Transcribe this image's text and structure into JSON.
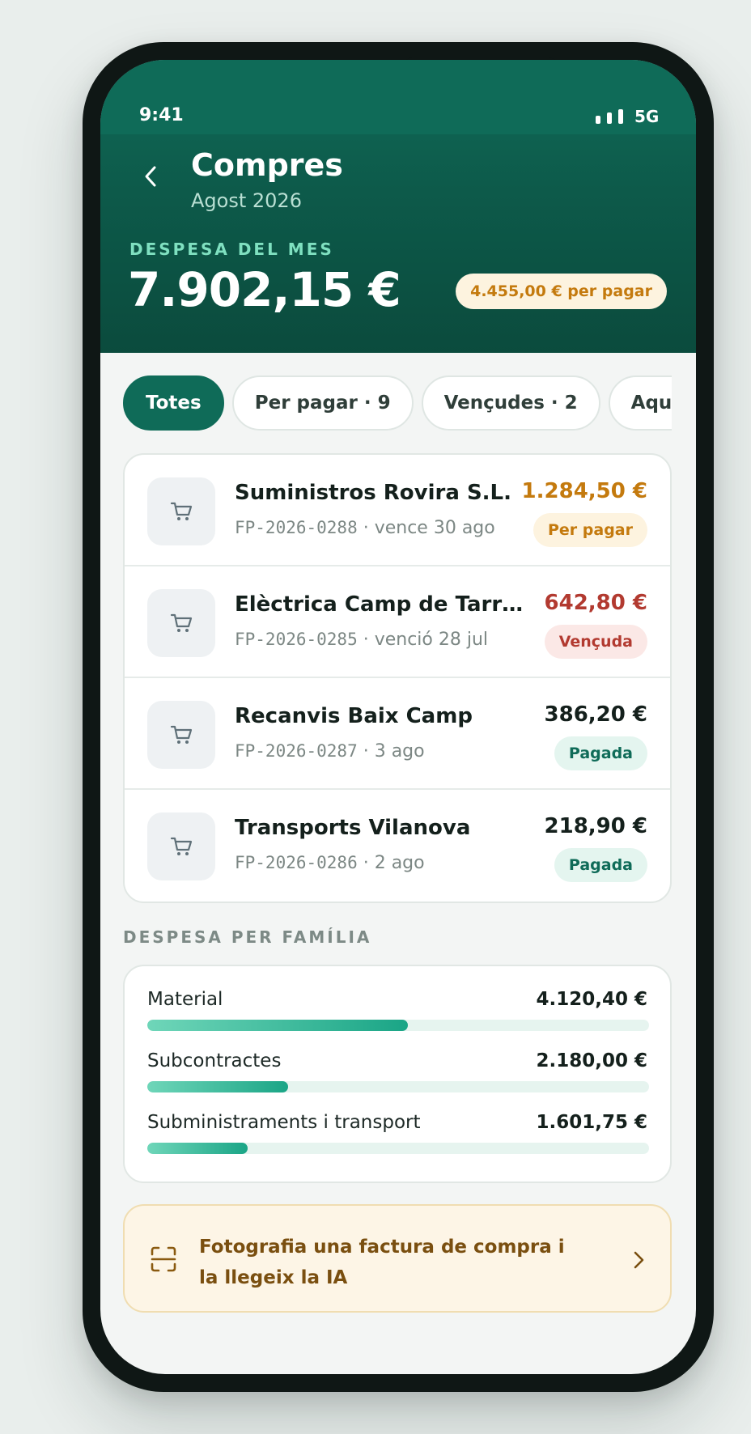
{
  "status": {
    "time": "9:41",
    "network": "5G"
  },
  "header": {
    "title": "Compres",
    "subtitle": "Agost 2026",
    "month_label": "DESPESA DEL MES",
    "month_total": "7.902,15 €",
    "pending": "4.455,00 € per pagar"
  },
  "filters": [
    {
      "label": "Totes",
      "active": true
    },
    {
      "label": "Per pagar · 9"
    },
    {
      "label": "Vençudes · 2"
    },
    {
      "label": "Aquest mes"
    }
  ],
  "invoices": [
    {
      "supplier": "Suministros Rovira S.L.",
      "ref": "FP-2026-0288",
      "date": "· vence 30 ago",
      "amount": "1.284,50 €",
      "status": "Per pagar",
      "amount_color": "#c47a0e",
      "badge_bg": "#fdf3df",
      "badge_fg": "#c47a0e",
      "icon": "cart-icon"
    },
    {
      "supplier": "Elèctrica Camp de Tarragona",
      "ref": "FP-2026-0285",
      "date": "· venció 28 jul",
      "amount": "642,80 €",
      "status": "Vençuda",
      "amount_color": "#b23a30",
      "badge_bg": "#fbe8e6",
      "badge_fg": "#b23a30",
      "icon": "cart-icon"
    },
    {
      "supplier": "Recanvis Baix Camp",
      "ref": "FP-2026-0287",
      "date": "· 3 ago",
      "amount": "386,20 €",
      "status": "Pagada",
      "amount_color": "#14201c",
      "badge_bg": "#e4f5ef",
      "badge_fg": "#0f6b58",
      "icon": "cart-icon"
    },
    {
      "supplier": "Transports Vilanova",
      "ref": "FP-2026-0286",
      "date": "· 2 ago",
      "amount": "218,90 €",
      "status": "Pagada",
      "amount_color": "#14201c",
      "badge_bg": "#e4f5ef",
      "badge_fg": "#0f6b58",
      "icon": "cart-icon"
    }
  ],
  "families": {
    "label": "DESPESA PER FAMÍLIA",
    "items": [
      {
        "name": "Material",
        "value": "4.120,40 €",
        "share": 0.52
      },
      {
        "name": "Subcontractes",
        "value": "2.180,00 €",
        "share": 0.28
      },
      {
        "name": "Subministraments i transport",
        "value": "1.601,75 €",
        "share": 0.2
      }
    ]
  },
  "ai_cta": {
    "text": "Fotografia una factura de compra i la llegeix la IA",
    "icon": "scan-icon"
  }
}
